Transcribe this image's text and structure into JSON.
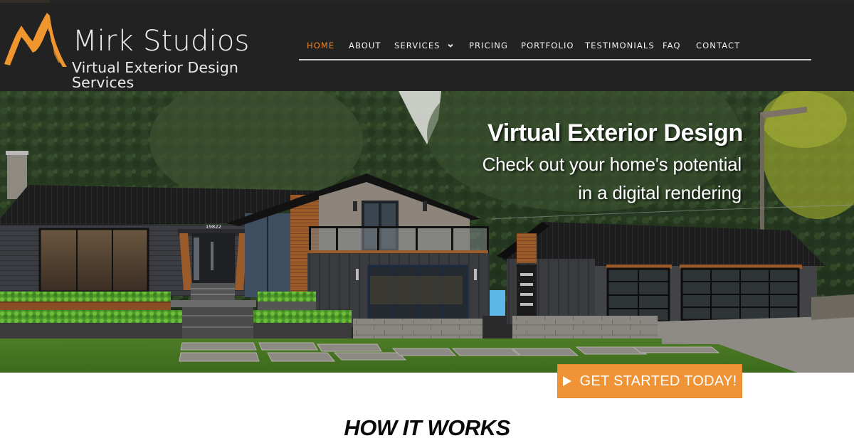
{
  "brand": {
    "name": "Mirk Studios",
    "tagline": "Virtual Exterior Design Services",
    "logo_icon": "brushstroke-m-logo",
    "accent_color": "#e8892b"
  },
  "nav": {
    "items": [
      {
        "label": "HOME",
        "active": true
      },
      {
        "label": "ABOUT",
        "active": false
      },
      {
        "label": "SERVICES",
        "active": false,
        "has_dropdown": true
      },
      {
        "label": "PRICING",
        "active": false
      },
      {
        "label": "PORTFOLIO",
        "active": false
      },
      {
        "label": "TESTIMONIALS",
        "active": false
      },
      {
        "label": "FAQ",
        "active": false
      },
      {
        "label": "CONTACT",
        "active": false
      }
    ],
    "dropdown_icon": "chevron-down-icon",
    "active_color": "#e8892b",
    "text_color": "#f2f2f2",
    "background_color": "#222222"
  },
  "hero": {
    "title": "Virtual Exterior Design",
    "subtitle_line1": "Check out your home's potential",
    "subtitle_line2": "in a digital rendering",
    "image_description": "Digital rendering of a modern dark-sided home with metal roof, wood accents, glass railings, two glass garage doors and landscaped lawn with stepping stones",
    "house_number": "19822"
  },
  "cta": {
    "label": "GET STARTED TODAY!",
    "icon": "play-triangle-icon",
    "color": "#ee9336"
  },
  "section": {
    "how_it_works_title": "HOW IT WORKS"
  }
}
